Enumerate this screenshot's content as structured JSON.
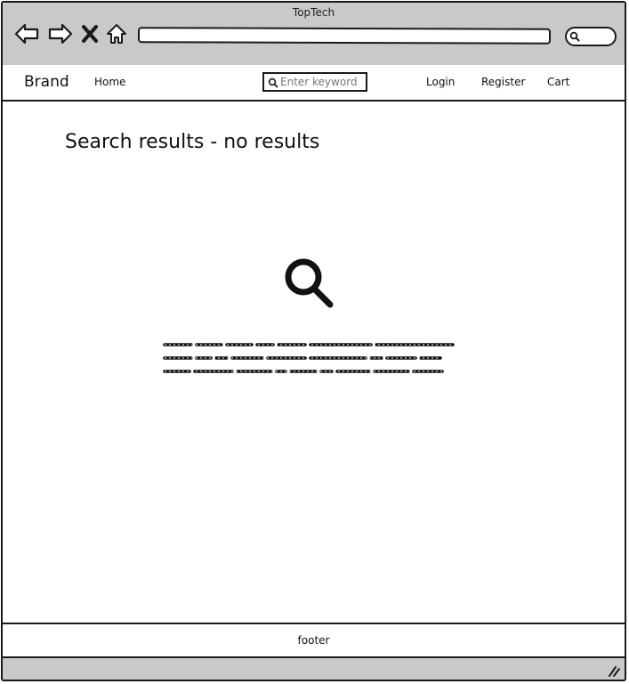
{
  "window": {
    "title": "TopTech"
  },
  "browser": {
    "icons": [
      "back-arrow-icon",
      "forward-arrow-icon",
      "stop-icon",
      "home-icon",
      "search-icon"
    ]
  },
  "navbar": {
    "brand": "Brand",
    "home": "Home",
    "search_placeholder": "Enter keyword",
    "login": "Login",
    "register": "Register",
    "cart": "Cart"
  },
  "main": {
    "title": "Search results - no results",
    "icon": "search-icon"
  },
  "footer": {
    "text": "footer"
  },
  "colors": {
    "chrome": "#c9c9c9",
    "stroke": "#1a1a1a",
    "background": "#ffffff"
  }
}
